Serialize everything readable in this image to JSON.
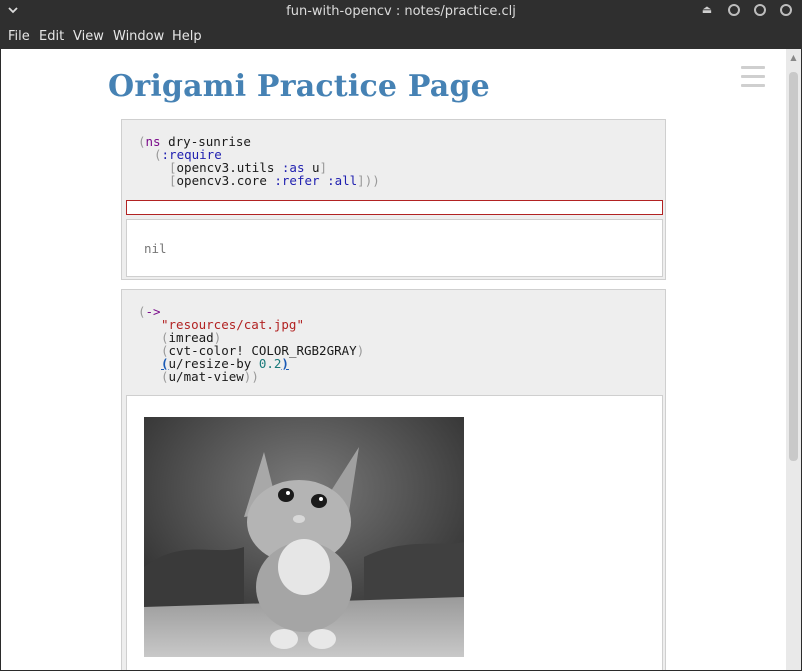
{
  "window": {
    "title": "fun-with-opencv : notes/practice.clj",
    "eject_glyph": "⏏"
  },
  "menubar": {
    "items": [
      "File",
      "Edit",
      "View",
      "Window",
      "Help"
    ]
  },
  "page": {
    "title": "Origami Practice Page"
  },
  "segments": [
    {
      "code": {
        "l1_open": "(",
        "l1_kw": "ns",
        "l1_name": " dry-sunrise",
        "l2_open": "(",
        "l2_kw": ":require",
        "l3_open": "[",
        "l3_ns": "opencv3.utils ",
        "l3_key": ":as",
        "l3_alias": " u",
        "l3_close": "]",
        "l4_open": "[",
        "l4_ns": "opencv3.core ",
        "l4_key1": ":refer",
        "l4_sp": " ",
        "l4_key2": ":all",
        "l4_close": "]))"
      },
      "output": "nil"
    },
    {
      "code": {
        "l1_open": "(",
        "l1_kw": "->",
        "l2_str": "\"resources/cat.jpg\"",
        "l3_open": "(",
        "l3_fn": "imread",
        "l3_close": ")",
        "l4_open": "(",
        "l4_fn": "cvt-color! COLOR_RGB2GRAY",
        "l4_close": ")",
        "l5_open": "(",
        "l5_fn": "u/resize-by ",
        "l5_num": "0.2",
        "l5_close": ")",
        "l6_open": "(",
        "l6_fn": "u/mat-view",
        "l6_close": "))"
      },
      "output_image": "grayscale cat photo"
    }
  ],
  "colors": {
    "title": "#4682b4",
    "keyword": "#7a0a8a",
    "keyword_arg": "#2020b0",
    "string": "#b22222",
    "number": "#1a7a7a"
  }
}
